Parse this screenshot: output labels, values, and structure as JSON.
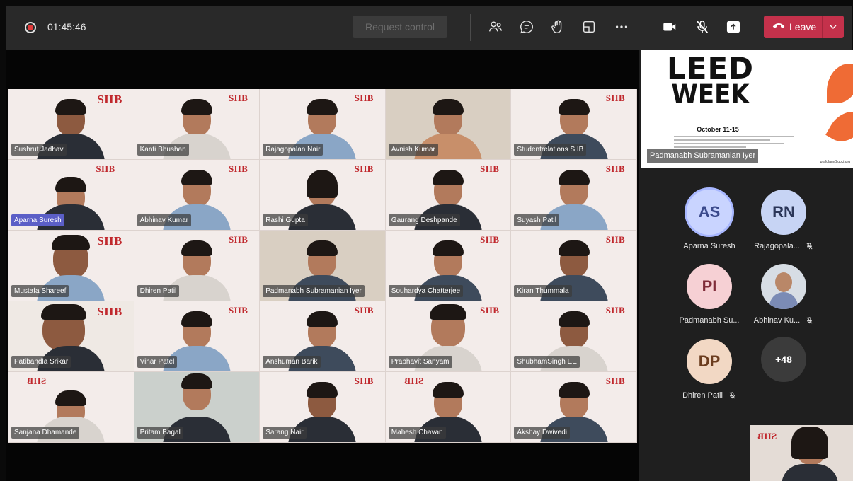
{
  "toolbar": {
    "timer": "01:45:46",
    "request_control_label": "Request control",
    "leave_label": "Leave",
    "icons": [
      "participants-icon",
      "chat-icon",
      "raise-hand-icon",
      "rooms-icon",
      "more-icon",
      "camera-icon",
      "mic-off-icon",
      "share-icon"
    ]
  },
  "gallery": {
    "logo_text": "SIIB",
    "logo_text_mirrored": "SIIB",
    "tiles": [
      {
        "name": "Sushrut  Jadhav"
      },
      {
        "name": "Kanti  Bhushan"
      },
      {
        "name": "Rajagopalan Nair"
      },
      {
        "name": "Avnish Kumar"
      },
      {
        "name": "Studentrelations SIIB"
      },
      {
        "name": "Aparna Suresh"
      },
      {
        "name": "Abhinav  Kumar"
      },
      {
        "name": "Rashi Gupta"
      },
      {
        "name": "Gaurang  Deshpande"
      },
      {
        "name": "Suyash Patil"
      },
      {
        "name": "Mustafa Shareef"
      },
      {
        "name": "Dhiren  Patil"
      },
      {
        "name": "Padmanabh Subramanian Iyer"
      },
      {
        "name": "Souhardya Chatterjee"
      },
      {
        "name": "Kiran Thummala"
      },
      {
        "name": "Patibandla Srikar"
      },
      {
        "name": "Vihar  Patel"
      },
      {
        "name": "Anshuman  Barik"
      },
      {
        "name": "Prabhavit  Sanyam"
      },
      {
        "name": "ShubhamSingh EE"
      },
      {
        "name": "Sanjana  Dhamande"
      },
      {
        "name": "Pritam  Bagal"
      },
      {
        "name": "Sarang Nair"
      },
      {
        "name": "Mahesh  Chavan"
      },
      {
        "name": "Akshay  Dwivedi"
      }
    ]
  },
  "shared_screen": {
    "title_line1": "LEED",
    "title_line2": "WEEK",
    "date": "October 11-15",
    "email": "prafulam@gbci.org",
    "presenter": "Padmanabh Subramanian Iyer"
  },
  "participants": [
    {
      "initials": "AS",
      "name": "Aparna Suresh",
      "muted": false
    },
    {
      "initials": "RN",
      "name": "Rajagopala...",
      "muted": true
    },
    {
      "initials": "PI",
      "name": "Padmanabh Su...",
      "muted": false
    },
    {
      "initials": "",
      "name": "Abhinav Ku...",
      "muted": true
    },
    {
      "initials": "DP",
      "name": "Dhiren Patil",
      "muted": true
    },
    {
      "initials": "+48",
      "name": "",
      "muted": false
    }
  ],
  "colors": {
    "leave": "#c4314b",
    "toolbar": "#292929",
    "panel": "#1f1f1f",
    "brand_red": "#c0282d",
    "active_ring": "#a8b7ff"
  }
}
